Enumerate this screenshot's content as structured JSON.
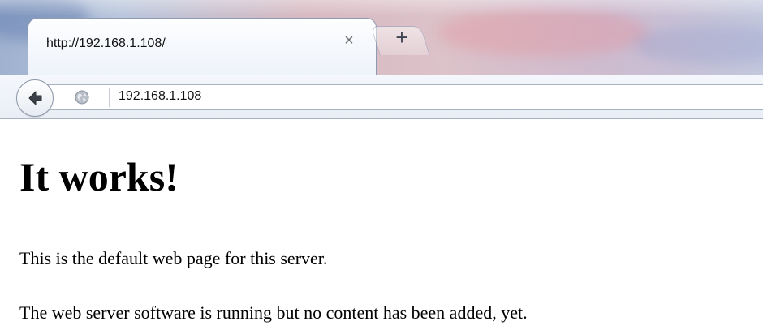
{
  "browser": {
    "tab": {
      "title": "http://192.168.1.108/",
      "close_glyph": "×"
    },
    "new_tab_glyph": "+",
    "toolbar": {
      "back_icon": "back-arrow-icon",
      "site_icon": "globe-icon",
      "address": "192.168.1.108"
    }
  },
  "page": {
    "heading": "It works!",
    "paragraphs": [
      "This is the default web page for this server.",
      "The web server software is running but no content has been added, yet."
    ]
  },
  "colors": {
    "tab_border": "#8e9bb2",
    "toolbar_bg": "#e9eef6",
    "text": "#000000"
  }
}
